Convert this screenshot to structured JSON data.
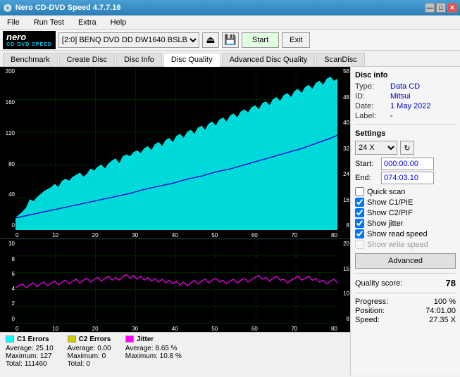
{
  "titleBar": {
    "title": "Nero CD-DVD Speed 4.7.7.16",
    "buttons": [
      "—",
      "□",
      "✕"
    ]
  },
  "menuBar": {
    "items": [
      "File",
      "Run Test",
      "Extra",
      "Help"
    ]
  },
  "toolbar": {
    "logo": "nero",
    "logoSub": "CD·DVD SPEED",
    "drive": "[2:0]  BENQ DVD DD DW1640 BSLB",
    "startLabel": "Start",
    "exitLabel": "Exit"
  },
  "tabs": [
    {
      "label": "Benchmark"
    },
    {
      "label": "Create Disc"
    },
    {
      "label": "Disc Info"
    },
    {
      "label": "Disc Quality",
      "active": true
    },
    {
      "label": "Advanced Disc Quality"
    },
    {
      "label": "ScanDisc"
    }
  ],
  "discInfo": {
    "sectionTitle": "Disc info",
    "rows": [
      {
        "label": "Type:",
        "value": "Data CD"
      },
      {
        "label": "ID:",
        "value": "Mitsui"
      },
      {
        "label": "Date:",
        "value": "1 May 2022"
      },
      {
        "label": "Label:",
        "value": "-"
      }
    ]
  },
  "settings": {
    "sectionTitle": "Settings",
    "speed": "24 X",
    "startLabel": "Start:",
    "startValue": "000:00.00",
    "endLabel": "End:",
    "endValue": "074:03.10",
    "checkboxes": [
      {
        "label": "Quick scan",
        "checked": false
      },
      {
        "label": "Show C1/PIE",
        "checked": true
      },
      {
        "label": "Show C2/PIF",
        "checked": true
      },
      {
        "label": "Show jitter",
        "checked": true
      },
      {
        "label": "Show read speed",
        "checked": true
      },
      {
        "label": "Show write speed",
        "checked": false,
        "disabled": true
      }
    ],
    "advancedLabel": "Advanced"
  },
  "qualityScore": {
    "label": "Quality score:",
    "value": "78"
  },
  "progress": {
    "rows": [
      {
        "label": "Progress:",
        "value": "100 %"
      },
      {
        "label": "Position:",
        "value": "74:01.00"
      },
      {
        "label": "Speed:",
        "value": "27.35 X"
      }
    ]
  },
  "legend": {
    "c1": {
      "title": "C1 Errors",
      "color": "#00ccff",
      "stats": [
        {
          "label": "Average:",
          "value": "25.10"
        },
        {
          "label": "Maximum:",
          "value": "127"
        },
        {
          "label": "Total:",
          "value": "111460"
        }
      ]
    },
    "c2": {
      "title": "C2 Errors",
      "color": "#cccc00",
      "stats": [
        {
          "label": "Average:",
          "value": "0.00"
        },
        {
          "label": "Maximum:",
          "value": "0"
        },
        {
          "label": "Total:",
          "value": "0"
        }
      ]
    },
    "jitter": {
      "title": "Jitter",
      "color": "#ff00ff",
      "stats": [
        {
          "label": "Average:",
          "value": "8.65 %"
        },
        {
          "label": "Maximum:",
          "value": "10.8 %"
        }
      ]
    }
  },
  "topChart": {
    "yAxisLabels": [
      "200",
      "160",
      "120",
      "80",
      "40",
      "0"
    ],
    "yAxisRight": [
      "56",
      "48",
      "40",
      "32",
      "24",
      "16",
      "8"
    ],
    "xAxisLabels": [
      "0",
      "10",
      "20",
      "30",
      "40",
      "50",
      "60",
      "70",
      "80"
    ]
  },
  "bottomChart": {
    "yAxisLabels": [
      "10",
      "8",
      "6",
      "4",
      "2",
      "0"
    ],
    "yAxisRight": [
      "20",
      "15",
      "10",
      "8"
    ],
    "xAxisLabels": [
      "0",
      "10",
      "20",
      "30",
      "40",
      "50",
      "60",
      "70",
      "80"
    ]
  }
}
